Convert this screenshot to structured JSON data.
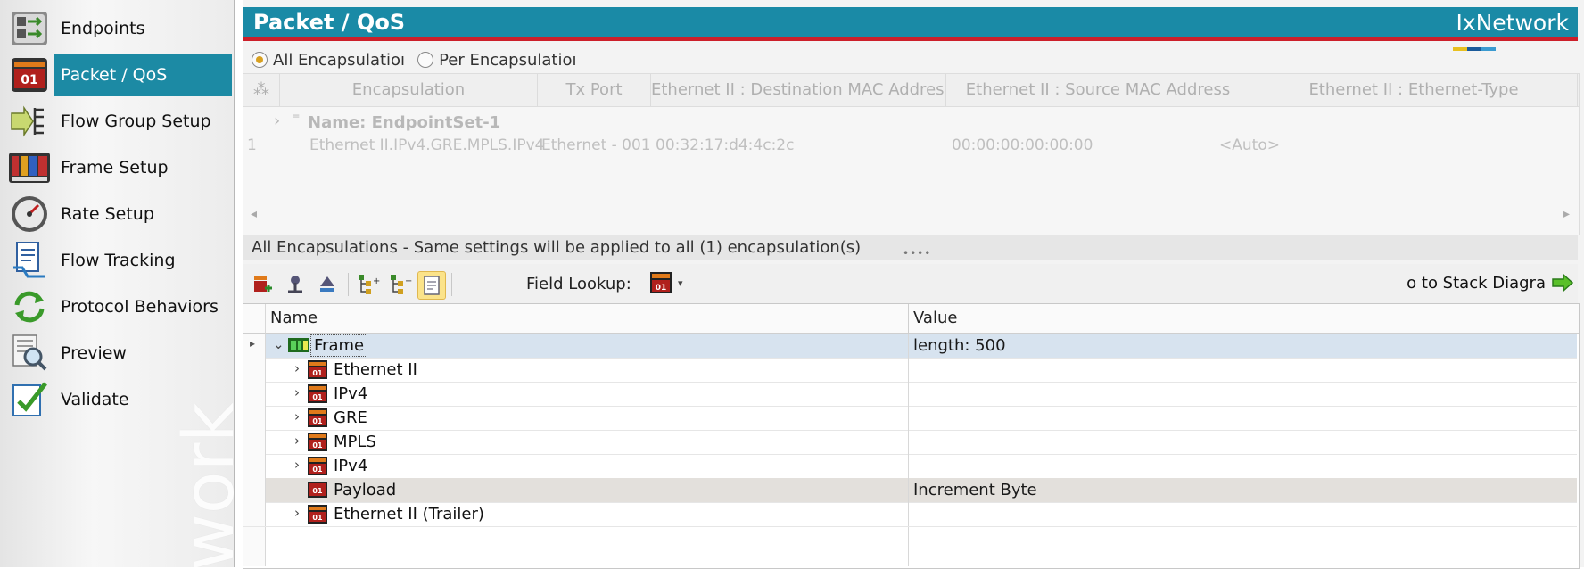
{
  "sidebar": {
    "items": [
      {
        "label": "Endpoints",
        "icon": "endpoints-icon"
      },
      {
        "label": "Packet / QoS",
        "icon": "packet-qos-icon",
        "active": true
      },
      {
        "label": "Flow Group Setup",
        "icon": "flow-group-icon"
      },
      {
        "label": "Frame Setup",
        "icon": "frame-setup-icon"
      },
      {
        "label": "Rate Setup",
        "icon": "gauge-icon"
      },
      {
        "label": "Flow Tracking",
        "icon": "flow-tracking-icon"
      },
      {
        "label": "Protocol Behaviors",
        "icon": "cycle-arrows-icon"
      },
      {
        "label": "Preview",
        "icon": "magnifier-icon"
      },
      {
        "label": "Validate",
        "icon": "checkmark-icon"
      }
    ],
    "watermark": "work"
  },
  "header": {
    "title": "Packet / QoS",
    "brand": "IxNetwork"
  },
  "encapsulation": {
    "options": [
      {
        "label": "All Encapsulatioı",
        "selected": true
      },
      {
        "label": "Per Encapsulatioı",
        "selected": false
      }
    ],
    "columns": [
      "Encapsulation",
      "Tx Port",
      "Ethernet II : Destination MAC Address",
      "Ethernet II : Source MAC Address",
      "Ethernet II : Ethernet-Type"
    ],
    "group_label": "Name: EndpointSet-1",
    "rows": [
      {
        "index": "1",
        "encapsulation": "Ethernet II.IPv4.GRE.MPLS.IPv4",
        "tx_port": "Ethernet - 001",
        "dst_mac": "00:32:17:d4:4c:2c",
        "src_mac": "00:00:00:00:00:00",
        "eth_type": "<Auto>"
      }
    ],
    "status": "All Encapsulations - Same settings will be applied to all (1) encapsulation(s)"
  },
  "toolbar": {
    "field_lookup_label": "Field Lookup:",
    "goto_stack_label": "o to Stack Diagra"
  },
  "tree": {
    "headers": {
      "name": "Name",
      "value": "Value"
    },
    "rows": [
      {
        "name": "Frame",
        "value": "length: 500",
        "level": 0,
        "expanded": true,
        "icon": "frame-icon",
        "selected": true
      },
      {
        "name": "Ethernet II",
        "value": "",
        "level": 1,
        "icon": "field-01-icon"
      },
      {
        "name": "IPv4",
        "value": "",
        "level": 1,
        "icon": "field-01-icon"
      },
      {
        "name": "GRE",
        "value": "",
        "level": 1,
        "icon": "field-01-icon"
      },
      {
        "name": "MPLS",
        "value": "",
        "level": 1,
        "icon": "field-01-icon"
      },
      {
        "name": "IPv4",
        "value": "",
        "level": 1,
        "icon": "field-01-icon"
      },
      {
        "name": "Payload",
        "value": "Increment Byte",
        "level": 1,
        "icon": "payload-01-icon",
        "highlight": true,
        "leaf": true
      },
      {
        "name": "Ethernet II (Trailer)",
        "value": "",
        "level": 1,
        "icon": "field-01-icon"
      }
    ]
  },
  "colors": {
    "accent": "#1a8aa6",
    "brand_red": "#cc1f2a",
    "selected_row": "#d7e3ef",
    "highlight_row": "#e3e0dc",
    "field_icon": "#b0201c"
  }
}
